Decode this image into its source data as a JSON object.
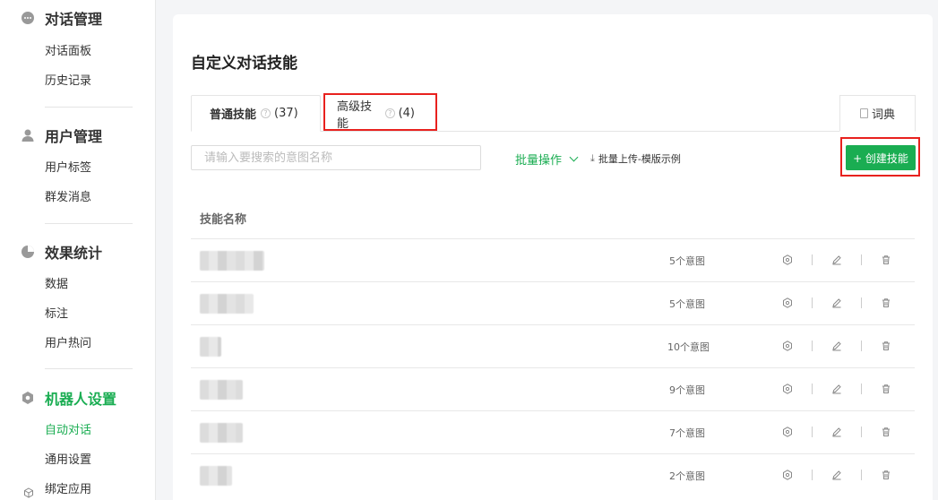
{
  "sidebar": {
    "groups": [
      {
        "title": "对话管理",
        "icon": "chat-dots-icon",
        "items": [
          "对话面板",
          "历史记录"
        ]
      },
      {
        "title": "用户管理",
        "icon": "user-icon",
        "items": [
          "用户标签",
          "群发消息"
        ]
      },
      {
        "title": "效果统计",
        "icon": "pie-chart-icon",
        "items": [
          "数据",
          "标注",
          "用户热问"
        ]
      },
      {
        "title": "机器人设置",
        "icon": "gear-icon",
        "items": [
          "自动对话",
          "通用设置",
          "绑定应用"
        ]
      }
    ],
    "active_group": "机器人设置",
    "active_item": "自动对话"
  },
  "main": {
    "title": "自定义对话技能",
    "tabs": [
      {
        "label": "普通技能",
        "count": "(37)"
      },
      {
        "label": "高级技能",
        "count": "(4)"
      }
    ],
    "dict_tab": "词典",
    "search_placeholder": "请输入要搜索的意图名称",
    "batch_label": "批量操作",
    "upload_label": "批量上传-模版示例",
    "create_label": "+ 创建技能",
    "table_header": "技能名称",
    "rows": [
      {
        "intents": "5个意图"
      },
      {
        "intents": "5个意图"
      },
      {
        "intents": "10个意图"
      },
      {
        "intents": "9个意图"
      },
      {
        "intents": "7个意图"
      },
      {
        "intents": "2个意图"
      }
    ]
  },
  "colors": {
    "accent": "#1aad52",
    "highlight": "#e8211e"
  }
}
